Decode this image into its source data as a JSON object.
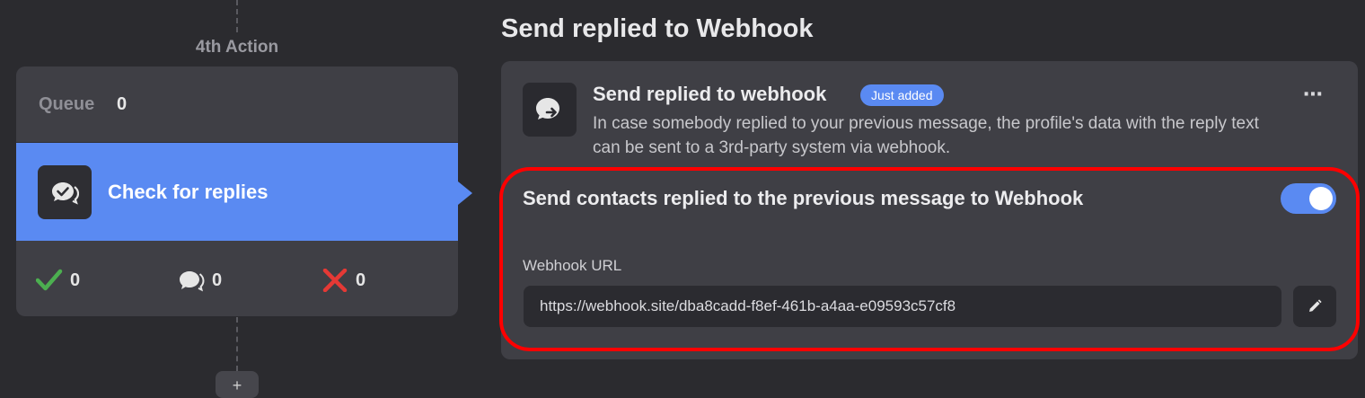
{
  "flow": {
    "action_label": "4th Action",
    "queue": {
      "label": "Queue",
      "count": "0"
    },
    "action": {
      "title": "Check for replies",
      "icon": "chat-check-icon"
    },
    "stats": [
      {
        "icon": "check-icon",
        "color": "#4caf50",
        "count": "0"
      },
      {
        "icon": "reply-chat-icon",
        "color": "#e6e6e6",
        "count": "0"
      },
      {
        "icon": "cross-icon",
        "color": "#e53935",
        "count": "0"
      }
    ]
  },
  "panel": {
    "title": "Send replied to Webhook",
    "card": {
      "icon": "webhook-chat-icon",
      "title": "Send replied to webhook",
      "badge": "Just added",
      "description": "In case somebody replied to your previous message, the profile's data with the reply text can be sent to a 3rd-party system via webhook.",
      "more_icon": "⋯"
    },
    "setting": {
      "label": "Send contacts replied to the previous message to Webhook",
      "enabled": true
    },
    "webhook": {
      "label": "Webhook URL",
      "value": "https://webhook.site/dba8cadd-f8ef-461b-a4aa-e09593c57cf8"
    }
  },
  "colors": {
    "accent": "#5a8af2",
    "highlight": "#ff0000",
    "background": "#2b2b2f",
    "card": "#3f3f45"
  }
}
